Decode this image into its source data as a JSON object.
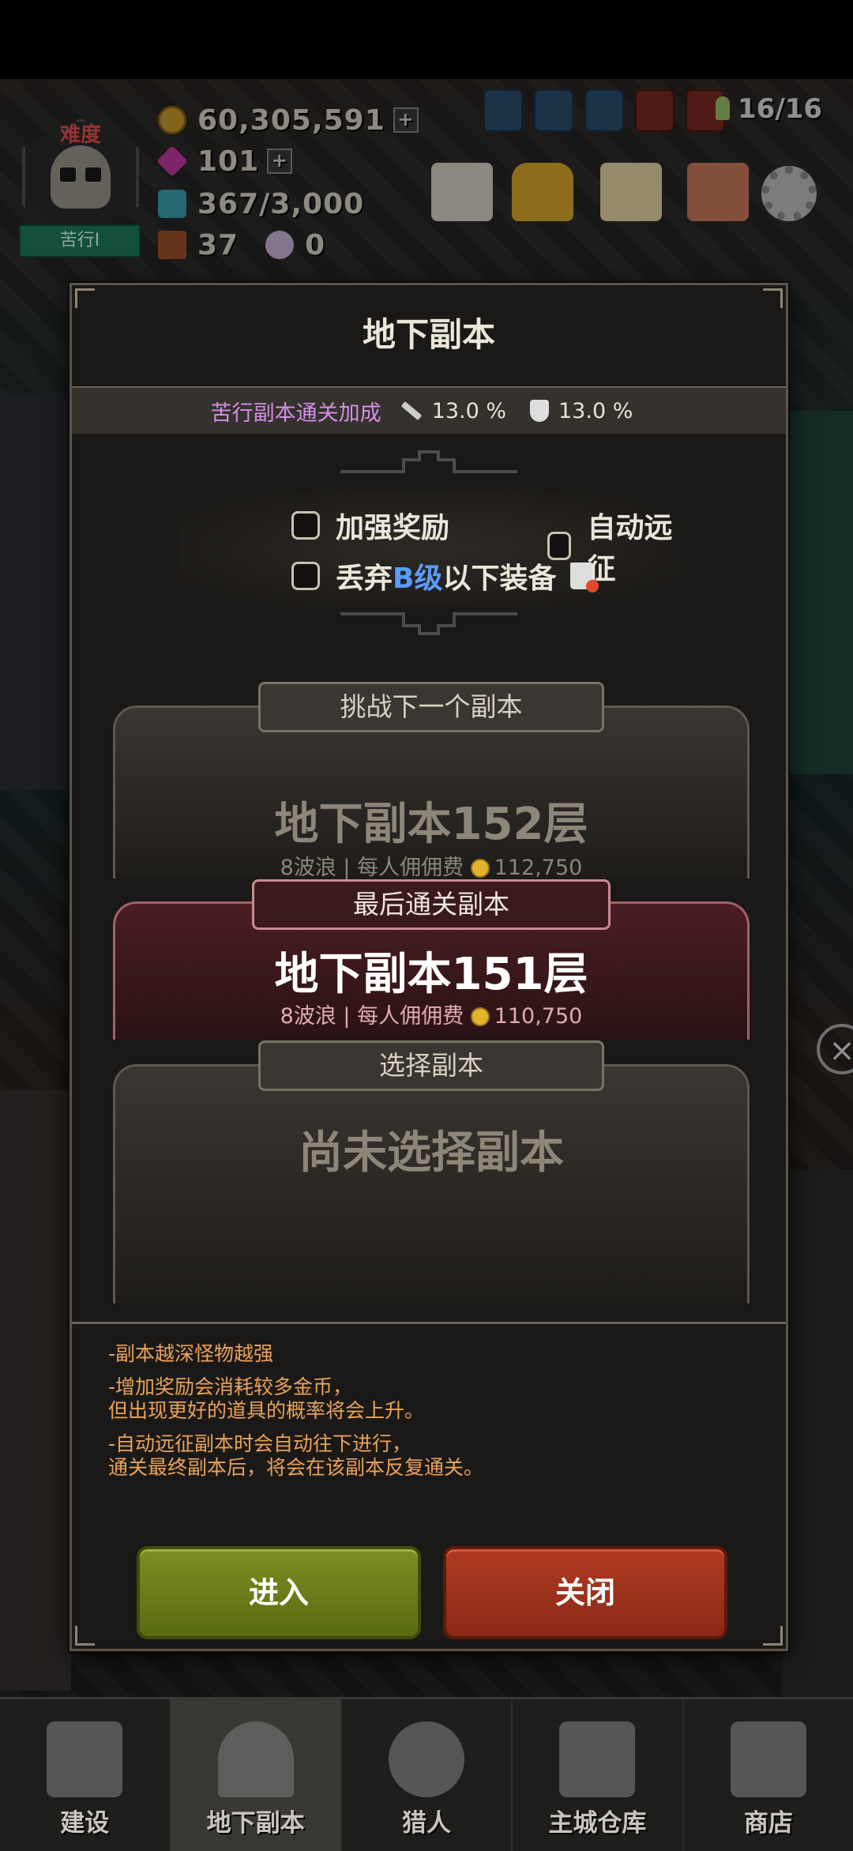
{
  "hud": {
    "difficulty": "难度",
    "mode": "苦行I",
    "gold": "60,305,591",
    "gems": "101",
    "energy": "367/3,000",
    "chests": "37",
    "crystals": "0",
    "population": "16/16",
    "icons": [
      "shield-icon",
      "team-icon",
      "upgrade-icon",
      "scroll-icon",
      "wing-icon",
      "book-icon",
      "trophy-icon",
      "letter-icon",
      "unit-icon",
      "gear-icon"
    ]
  },
  "dialog": {
    "title": "地下副本",
    "bonus": {
      "label": "苦行副本通关加成",
      "attack": "13.0 %",
      "defense": "13.0 %"
    },
    "options": {
      "boost_reward": "加强奖励",
      "auto_expedition": "自动远征",
      "discard_prefix": "丢弃",
      "discard_grade": "B级",
      "discard_suffix": "以下装备"
    },
    "next": {
      "tab": "挑战下一个副本",
      "name": "地下副本152层",
      "waves": "8波浪",
      "fee_label": "每人佣佣费",
      "fee": "112,750"
    },
    "last": {
      "tab": "最后通关副本",
      "name": "地下副本151层",
      "waves": "8波浪",
      "fee_label": "每人佣佣费",
      "fee": "110,750"
    },
    "select": {
      "tab": "选择副本",
      "name": "尚未选择副本"
    },
    "notes": [
      "-副本越深怪物越强",
      "-增加奖励会消耗较多金币，\n  但出现更好的道具的概率将会上升。",
      "-自动远征副本时会自动往下进行，\n  通关最终副本后，将会在该副本反复通关。"
    ],
    "enter_label": "进入",
    "close_label": "关闭"
  },
  "nav": [
    {
      "label": "建设",
      "icon": "hammer-icon"
    },
    {
      "label": "地下副本",
      "icon": "dungeon-gate-icon"
    },
    {
      "label": "猎人",
      "icon": "hunter-icon"
    },
    {
      "label": "主城仓库",
      "icon": "chest-icon"
    },
    {
      "label": "商店",
      "icon": "shop-icon"
    }
  ],
  "colors": {
    "bonus_label": "#d48ee6",
    "grade_b": "#5a9cff",
    "notes": "#e9a25a",
    "enter": "#7d8e22",
    "close": "#b03a22"
  }
}
